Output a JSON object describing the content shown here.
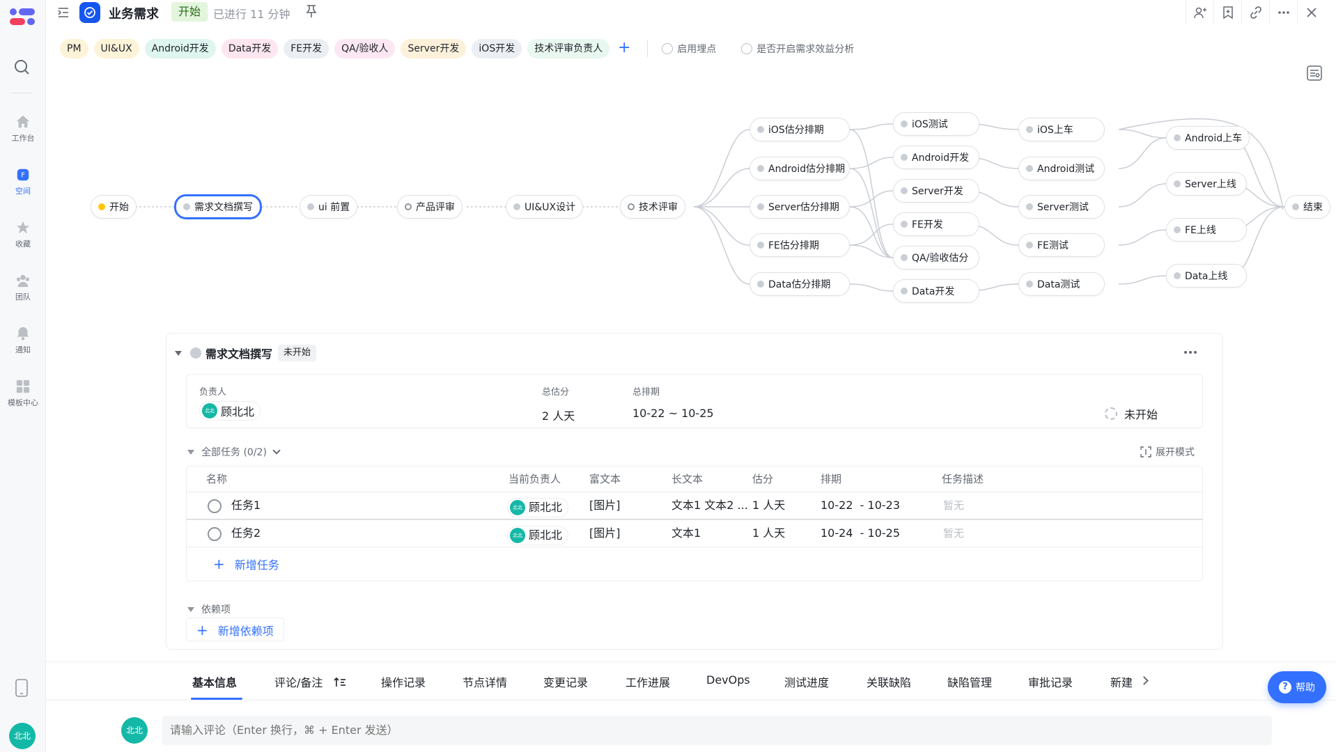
{
  "rail": {
    "items": [
      {
        "label": "工作台",
        "icon": "home-icon"
      },
      {
        "label": "空间",
        "icon": "space-icon"
      },
      {
        "label": "收藏",
        "icon": "star-icon"
      },
      {
        "label": "团队",
        "icon": "team-icon"
      },
      {
        "label": "通知",
        "icon": "bell-icon"
      },
      {
        "label": "模板中心",
        "icon": "grid-icon"
      }
    ],
    "user": "北北"
  },
  "header": {
    "title": "业务需求",
    "stage": "开始",
    "elapsed": "已进行 11 分钟"
  },
  "roles": [
    "PM",
    "UI&UX",
    "Android开发",
    "Data开发",
    "FE开发",
    "QA/验收人",
    "Server开发",
    "iOS开发",
    "技术评审负责人"
  ],
  "role_colors": [
    "#fdf3d8",
    "#fdf3d8",
    "#dff5ef",
    "#fde6ef",
    "#ebeef2",
    "#fce7f3",
    "#fdf1db",
    "#ebeef2",
    "#e8f7ef"
  ],
  "options": [
    "启用埋点",
    "是否开启需求效益分析"
  ],
  "flow": {
    "start": "开始",
    "doc": "需求文档撰写",
    "ui_pre": "ui 前置",
    "review": "产品评审",
    "design": "UI&UX设计",
    "tech": "技术评审",
    "ios_est": "iOS估分排期",
    "android_est": "Android估分排期",
    "server_est": "Server估分排期",
    "fe_est": "FE估分排期",
    "data_est": "Data估分排期",
    "ios_test": "iOS测试",
    "android_dev": "Android开发",
    "server_dev": "Server开发",
    "fe_dev": "FE开发",
    "qa_est": "QA/验收估分",
    "data_dev": "Data开发",
    "ios_car": "iOS上车",
    "android_test": "Android测试",
    "server_test": "Server测试",
    "fe_test": "FE测试",
    "data_test": "Data测试",
    "android_car": "Android上车",
    "server_online": "Server上线",
    "fe_online": "FE上线",
    "data_online": "Data上线",
    "end": "结束"
  },
  "node_detail": {
    "name": "需求文档撰写",
    "status": "未开始",
    "owner_label": "负责人",
    "owner": "顾北北",
    "owner_avatar": "北北",
    "estimate_label": "总估分",
    "estimate": "2 人天",
    "schedule_label": "总排期",
    "schedule": "10-22 ~ 10-25",
    "progress_status": "未开始"
  },
  "tasks": {
    "header": "全部任务 (0/2)",
    "expand_label": "展开模式",
    "columns": [
      "名称",
      "当前负责人",
      "富文本",
      "长文本",
      "估分",
      "排期",
      "任务描述"
    ],
    "rows": [
      {
        "name": "任务1",
        "owner": "顾北北",
        "rich": "[图片]",
        "long": "文本1 文本2 ...",
        "estimate": "1 人天",
        "schedule": "10-22  - 10-23",
        "desc": "暂无"
      },
      {
        "name": "任务2",
        "owner": "顾北北",
        "rich": "[图片]",
        "long": "文本1",
        "estimate": "1 人天",
        "schedule": "10-24  - 10-25",
        "desc": "暂无"
      }
    ],
    "add_label": "新增任务"
  },
  "deps": {
    "header": "依赖项",
    "add_label": "新增依赖项"
  },
  "tabs": [
    "基本信息",
    "评论/备注",
    "操作记录",
    "节点详情",
    "变更记录",
    "工作进展",
    "DevOps",
    "测试进度",
    "关联缺陷",
    "缺陷管理",
    "审批记录",
    "新建"
  ],
  "help": "帮助",
  "comment": {
    "avatar": "北北",
    "placeholder": "请输入评论（Enter 换行，⌘ + Enter 发送）"
  },
  "colors": {
    "accent": "#3370ff",
    "avatar": "#14b8a6",
    "stage_bg": "#e3f5dc"
  }
}
